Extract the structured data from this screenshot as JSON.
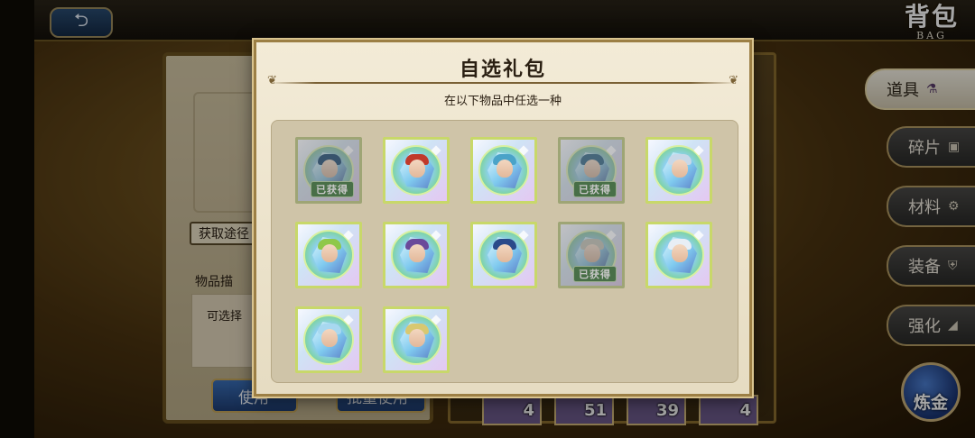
{
  "screen": {
    "title_cn": "背包",
    "title_en": "BAG",
    "back_icon": "back-arrow-icon"
  },
  "info_panel": {
    "acquire_label": "获取途径",
    "desc_label": "物品描",
    "desc_text": "可选择",
    "use_label": "使用",
    "batch_use_label": "批量使用"
  },
  "bag_slots": [
    "4",
    "51",
    "39",
    "4"
  ],
  "side_tabs": [
    {
      "label": "道具",
      "icon": "flask-icon",
      "active": true
    },
    {
      "label": "碎片",
      "icon": "shard-icon",
      "active": false
    },
    {
      "label": "材料",
      "icon": "gear-icon",
      "active": false
    },
    {
      "label": "装备",
      "icon": "armor-icon",
      "active": false
    },
    {
      "label": "强化",
      "icon": "enhance-icon",
      "active": false
    }
  ],
  "alchemy_label": "炼金",
  "modal": {
    "title": "自选礼包",
    "subtitle": "在以下物品中任选一种",
    "owned_label": "已获得",
    "items": [
      {
        "owned": true,
        "hair": "#2f6fa8"
      },
      {
        "owned": false,
        "hair": "#c0392b"
      },
      {
        "owned": false,
        "hair": "#4aa3c8"
      },
      {
        "owned": true,
        "hair": "#3d88b8"
      },
      {
        "owned": false,
        "hair": "#c8d8e8"
      },
      {
        "owned": false,
        "hair": "#8fc84a"
      },
      {
        "owned": false,
        "hair": "#6a4a9a"
      },
      {
        "owned": false,
        "hair": "#2a4a8a"
      },
      {
        "owned": true,
        "hair": "#c8c8b8"
      },
      {
        "owned": false,
        "hair": "#e8eef5"
      },
      {
        "owned": false,
        "hair": "#a8d8f0"
      },
      {
        "owned": false,
        "hair": "#d8c870"
      }
    ]
  }
}
